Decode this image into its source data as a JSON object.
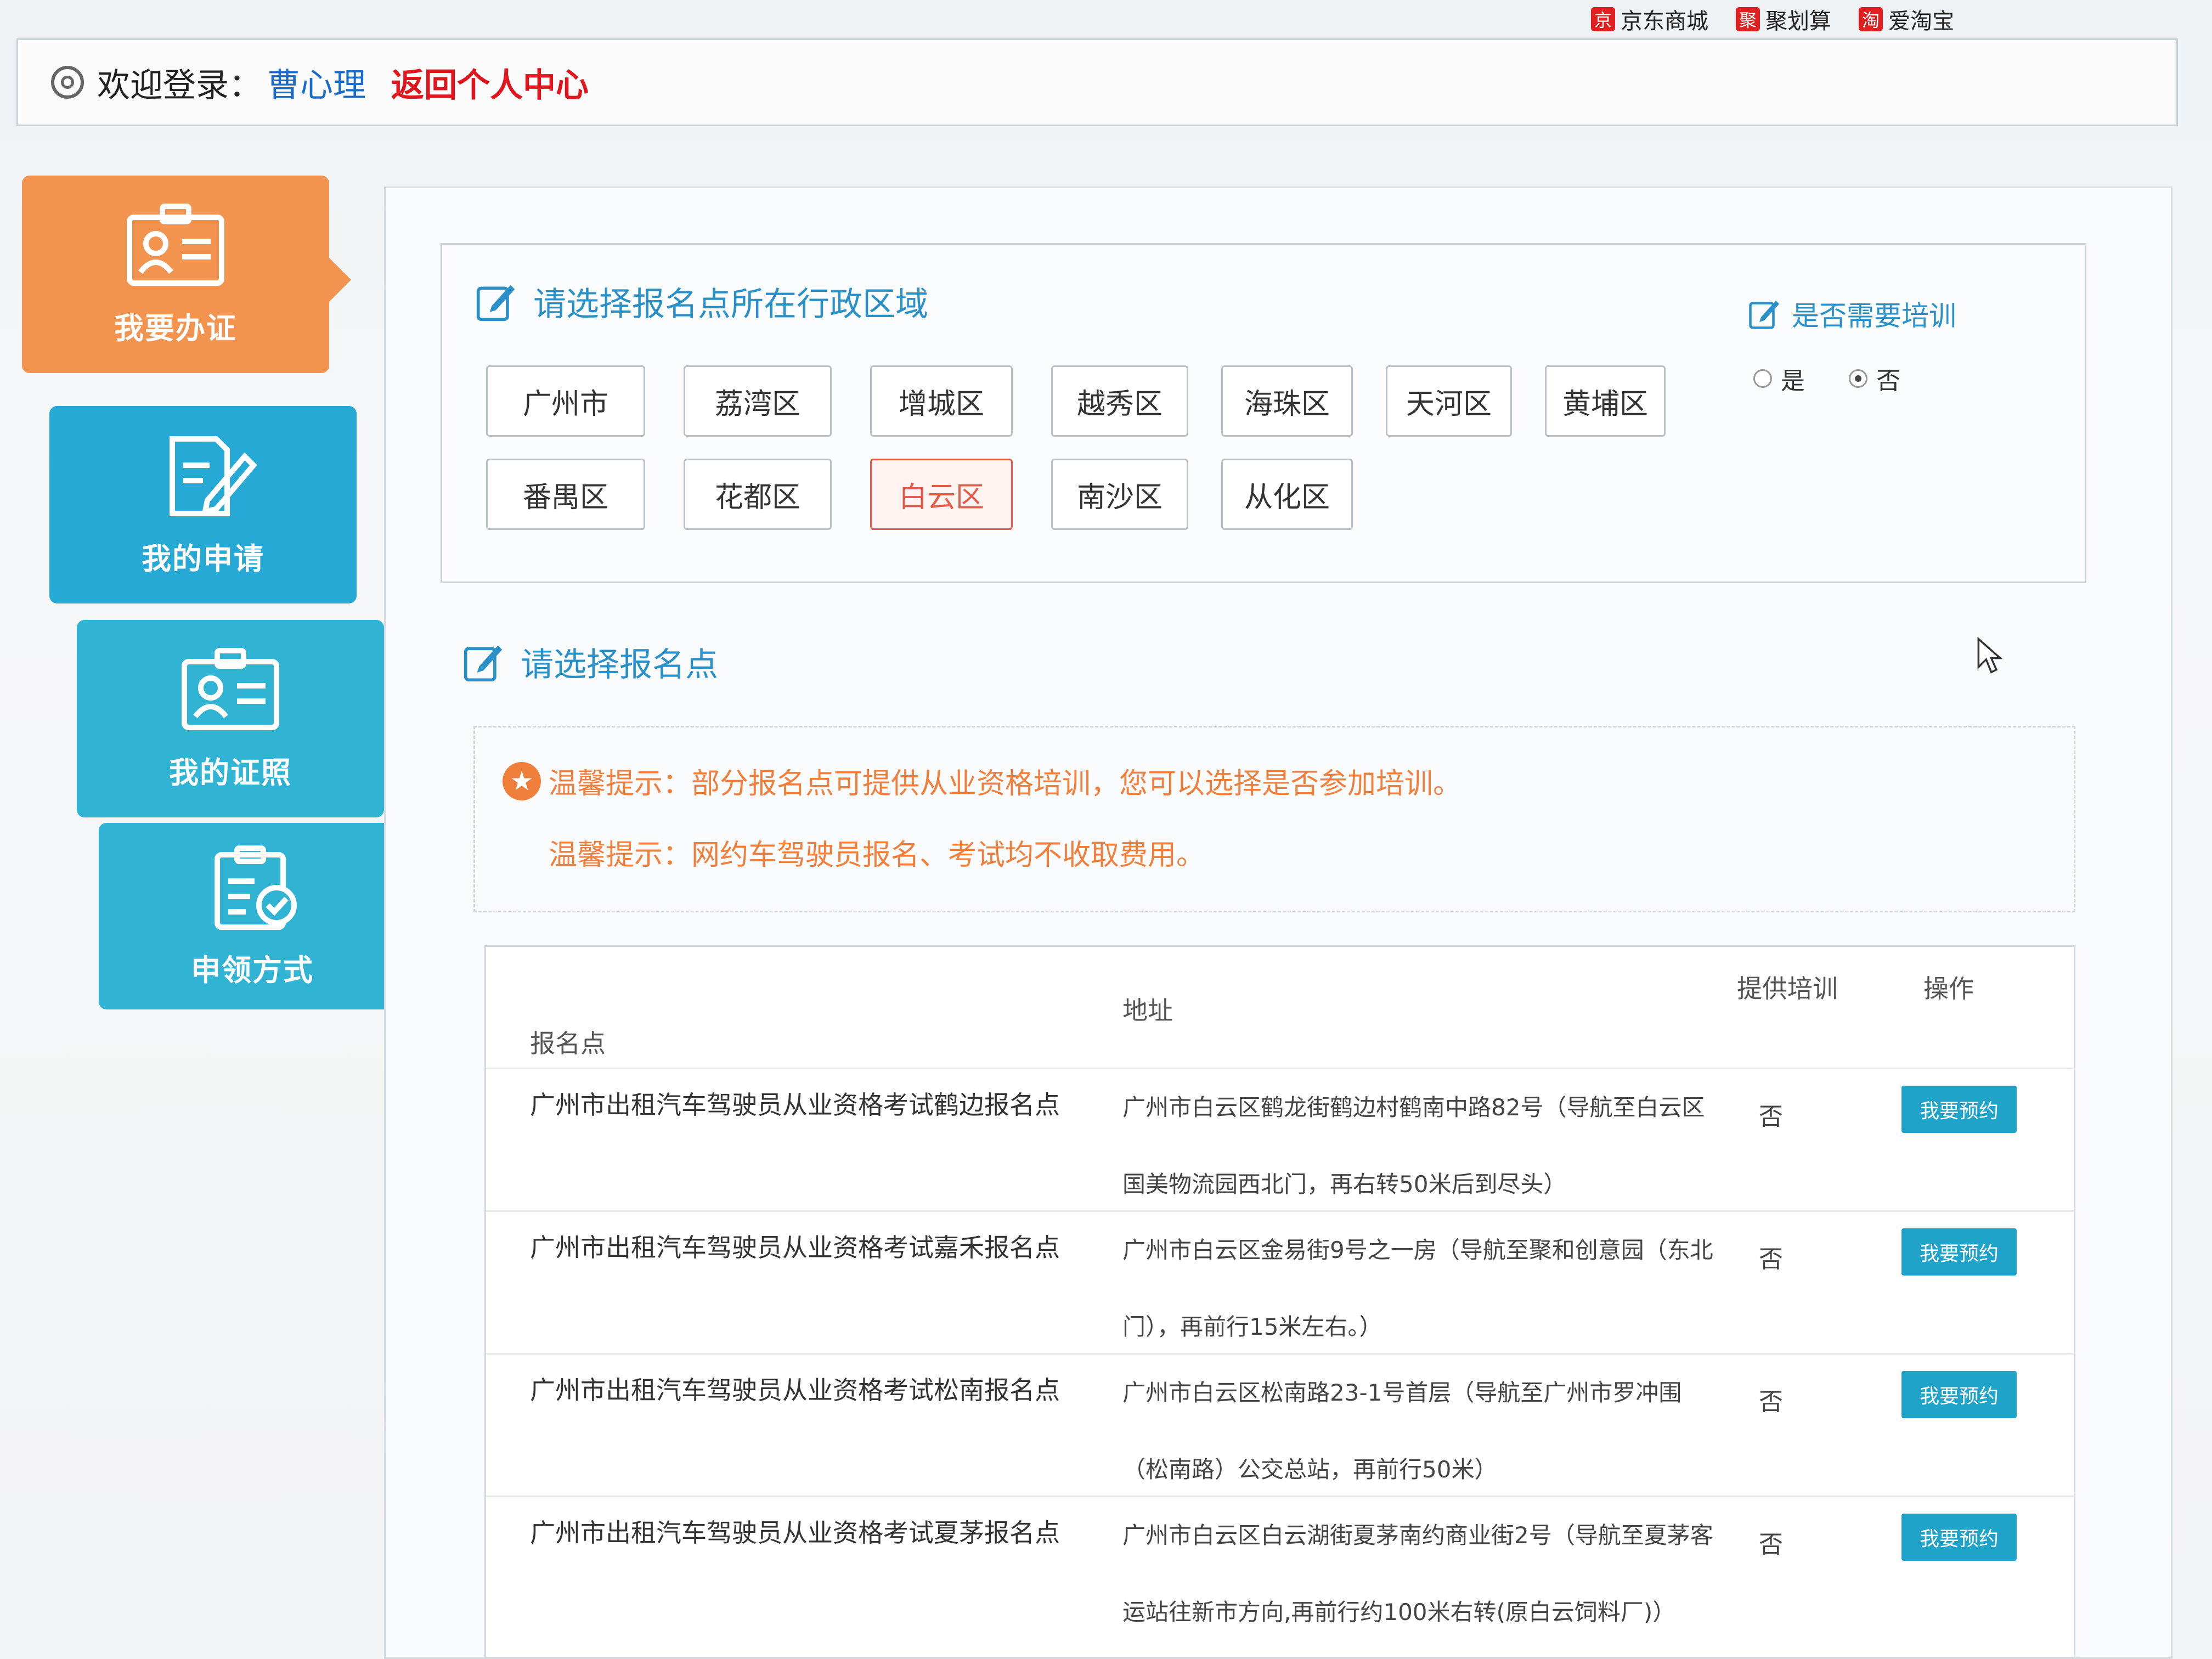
{
  "browser": {
    "favorites": [
      {
        "icon": "京",
        "label": "京东商城"
      },
      {
        "icon": "聚",
        "label": "聚划算"
      },
      {
        "icon": "淘",
        "label": "爱淘宝"
      }
    ]
  },
  "header": {
    "welcome": "欢迎登录：",
    "username": "曹心理",
    "back_link": "返回个人中心"
  },
  "sidebar": {
    "items": [
      {
        "label": "我要办证",
        "icon": "id-card-icon",
        "active": true
      },
      {
        "label": "我的申请",
        "icon": "edit-document-icon"
      },
      {
        "label": "我的证照",
        "icon": "license-icon"
      },
      {
        "label": "申领方式",
        "icon": "clipboard-check-icon"
      }
    ]
  },
  "region_section": {
    "title": "请选择报名点所在行政区域",
    "districts": [
      "广州市",
      "荔湾区",
      "增城区",
      "越秀区",
      "海珠区",
      "天河区",
      "黄埔区",
      "番禺区",
      "花都区",
      "白云区",
      "南沙区",
      "从化区"
    ],
    "selected": "白云区"
  },
  "training": {
    "title": "是否需要培训",
    "options": [
      "是",
      "否"
    ],
    "selected": "否"
  },
  "site_section": {
    "title": "请选择报名点"
  },
  "notices": [
    "温馨提示：部分报名点可提供从业资格培训，您可以选择是否参加培训。",
    "温馨提示：网约车驾驶员报名、考试均不收取费用。"
  ],
  "table": {
    "headers": {
      "name": "报名点",
      "address": "地址",
      "training": "提供培训",
      "action": "操作"
    },
    "rows": [
      {
        "name": "广州市出租汽车驾驶员从业资格考试鹤边报名点",
        "address": "广州市白云区鹤龙街鹤边村鹤南中路82号（导航至白云区国美物流园西北门，再右转50米后到尽头）",
        "training": "否",
        "action": "我要预约"
      },
      {
        "name": "广州市出租汽车驾驶员从业资格考试嘉禾报名点",
        "address": "广州市白云区金易街9号之一房（导航至聚和创意园（东北门），再前行15米左右。）",
        "training": "否",
        "action": "我要预约"
      },
      {
        "name": "广州市出租汽车驾驶员从业资格考试松南报名点",
        "address": "广州市白云区松南路23-1号首层（导航至广州市罗冲围（松南路）公交总站，再前行50米）",
        "training": "否",
        "action": "我要预约"
      },
      {
        "name": "广州市出租汽车驾驶员从业资格考试夏茅报名点",
        "address": "广州市白云区白云湖街夏茅南约商业街2号（导航至夏茅客运站往新市方向,再前行约100米右转(原白云饲料厂)）",
        "training": "否",
        "action": "我要预约"
      }
    ]
  },
  "colors": {
    "accent_blue": "#2a90c8",
    "active_orange": "#f29450",
    "selected_red": "#e55a48",
    "notice_orange": "#f07f3c",
    "button_teal": "#1fa3c8"
  }
}
